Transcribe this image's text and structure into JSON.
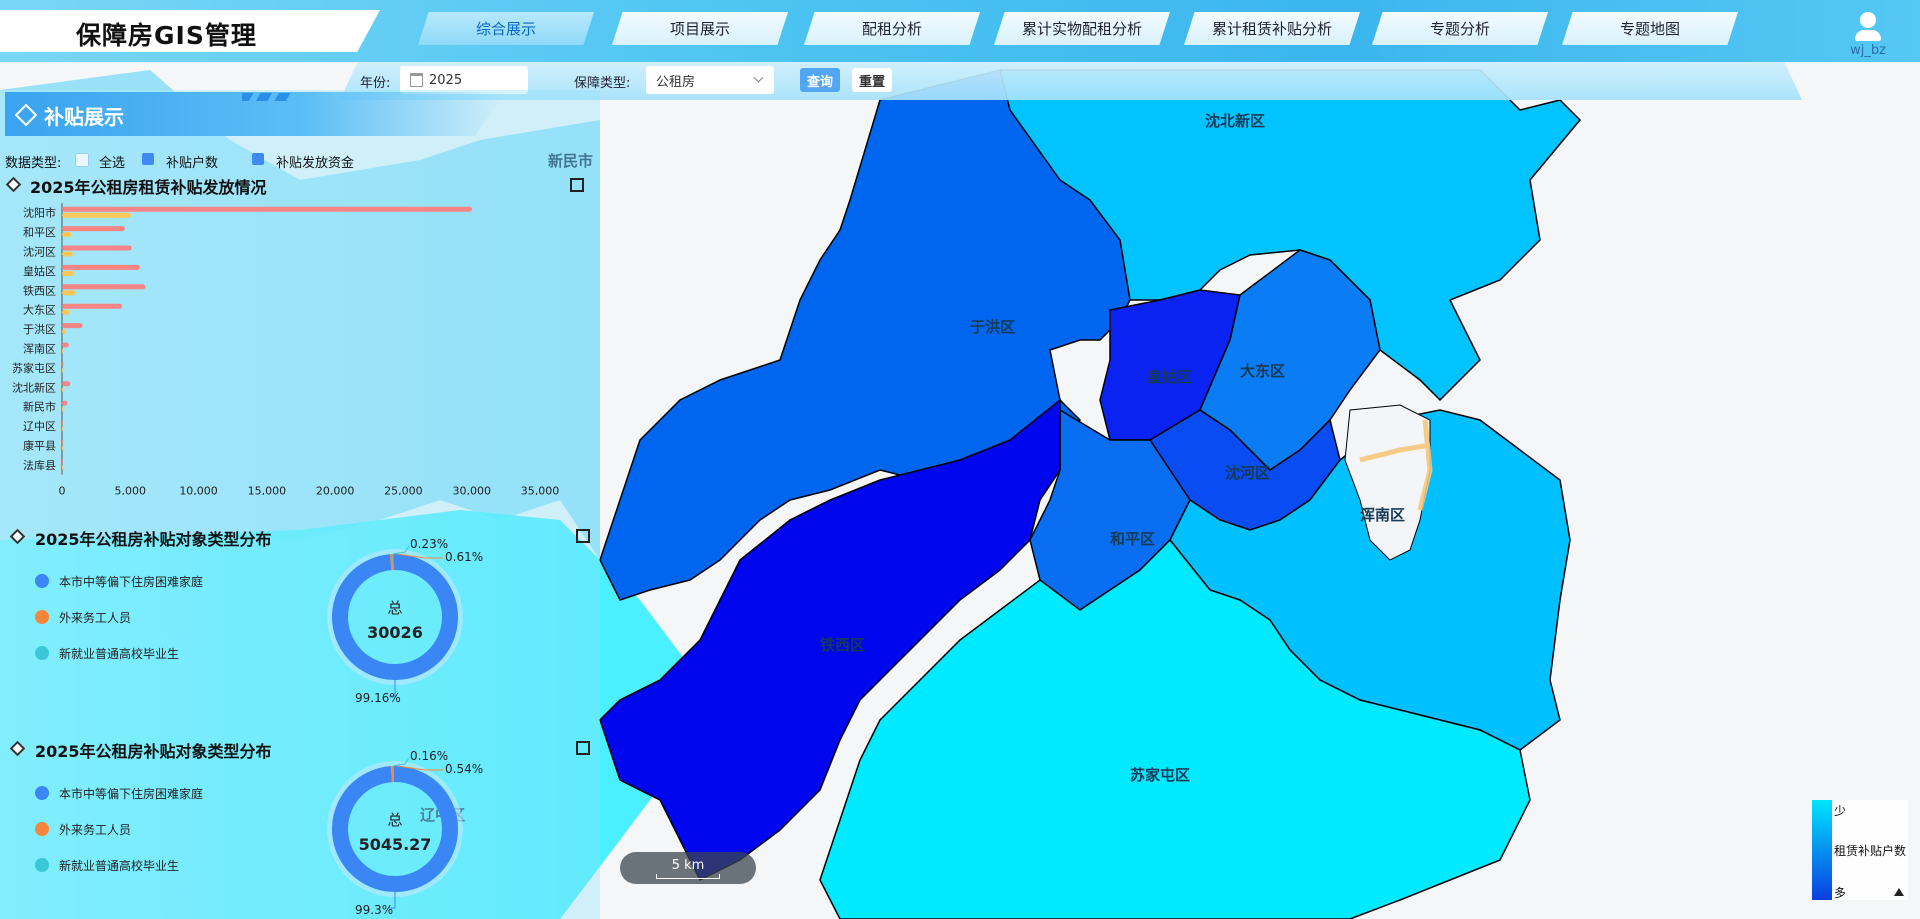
{
  "header": {
    "title": "保障房GIS管理",
    "nav": [
      {
        "label": "综合展示",
        "active": true
      },
      {
        "label": "项目展示",
        "active": false
      },
      {
        "label": "配租分析",
        "active": false
      },
      {
        "label": "累计实物配租分析",
        "active": false
      },
      {
        "label": "累计租赁补贴分析",
        "active": false
      },
      {
        "label": "专题分析",
        "active": false
      },
      {
        "label": "专题地图",
        "active": false
      }
    ],
    "user": "wj_bz"
  },
  "filters": {
    "year_label": "年份:",
    "year_value": "2025",
    "type_label": "保障类型:",
    "type_value": "公租房",
    "query_label": "查询",
    "reset_label": "重置"
  },
  "panel": {
    "title": "补贴展示",
    "data_type_label": "数据类型:",
    "checkbox_all": "全选",
    "checkbox_households": "补贴户数",
    "checkbox_funds": "补贴发放资金"
  },
  "chart_data": [
    {
      "type": "bar",
      "title": "2025年公租房租赁补贴发放情况",
      "categories": [
        "沈阳市",
        "和平区",
        "沈河区",
        "皇姑区",
        "铁西区",
        "大东区",
        "于洪区",
        "浑南区",
        "苏家屯区",
        "沈北新区",
        "新民市",
        "辽中区",
        "康平县",
        "法库县"
      ],
      "series": [
        {
          "values": [
            30026,
            4600,
            5100,
            5700,
            6100,
            4400,
            1500,
            500,
            100,
            600,
            400,
            50,
            30,
            30
          ],
          "color": "#f58484"
        },
        {
          "values": [
            5045,
            700,
            800,
            900,
            1000,
            600,
            300,
            80,
            20,
            100,
            60,
            10,
            5,
            5
          ],
          "color": "#fbc755"
        }
      ],
      "x_ticks": [
        "0",
        "5,000",
        "10,000",
        "15,000",
        "20,000",
        "25,000",
        "30,000",
        "35,000"
      ],
      "xlim": [
        0,
        35000
      ],
      "orientation": "horizontal"
    },
    {
      "type": "pie",
      "title": "2025年公租房补贴对象类型分布",
      "labels": [
        "本市中等偏下住房困难家庭",
        "外来务工人员",
        "新就业普通高校毕业生"
      ],
      "values": [
        99.16,
        0.61,
        0.23
      ],
      "value_labels": [
        "99.16%",
        "0.61%",
        "0.23%"
      ],
      "colors": [
        "#3a86f5",
        "#f7853a",
        "#3ac8d8"
      ],
      "center_label": "总",
      "center_value": "30026"
    },
    {
      "type": "pie",
      "title": "2025年公租房补贴对象类型分布",
      "labels": [
        "本市中等偏下住房困难家庭",
        "外来务工人员",
        "新就业普通高校毕业生"
      ],
      "values": [
        99.3,
        0.54,
        0.16
      ],
      "value_labels": [
        "99.3%",
        "0.54%",
        "0.16%"
      ],
      "colors": [
        "#3a86f5",
        "#f7853a",
        "#3ac8d8"
      ],
      "center_label": "总",
      "center_value": "5045.27"
    }
  ],
  "map": {
    "districts": [
      {
        "name": "沈北新区",
        "level": "low"
      },
      {
        "name": "于洪区",
        "level": "mid"
      },
      {
        "name": "皇姑区",
        "level": "high"
      },
      {
        "name": "大东区",
        "level": "mid"
      },
      {
        "name": "沈河区",
        "level": "high"
      },
      {
        "name": "和平区",
        "level": "mid"
      },
      {
        "name": "铁西区",
        "level": "max"
      },
      {
        "name": "浑南区",
        "level": "low"
      },
      {
        "name": "苏家屯区",
        "level": "min"
      },
      {
        "name": "新民市",
        "level": "none"
      },
      {
        "name": "辽中区",
        "level": "none"
      }
    ],
    "scale_label": "5 km",
    "legend_low": "少",
    "legend_high": "多",
    "legend_title": "租赁补贴户数"
  }
}
